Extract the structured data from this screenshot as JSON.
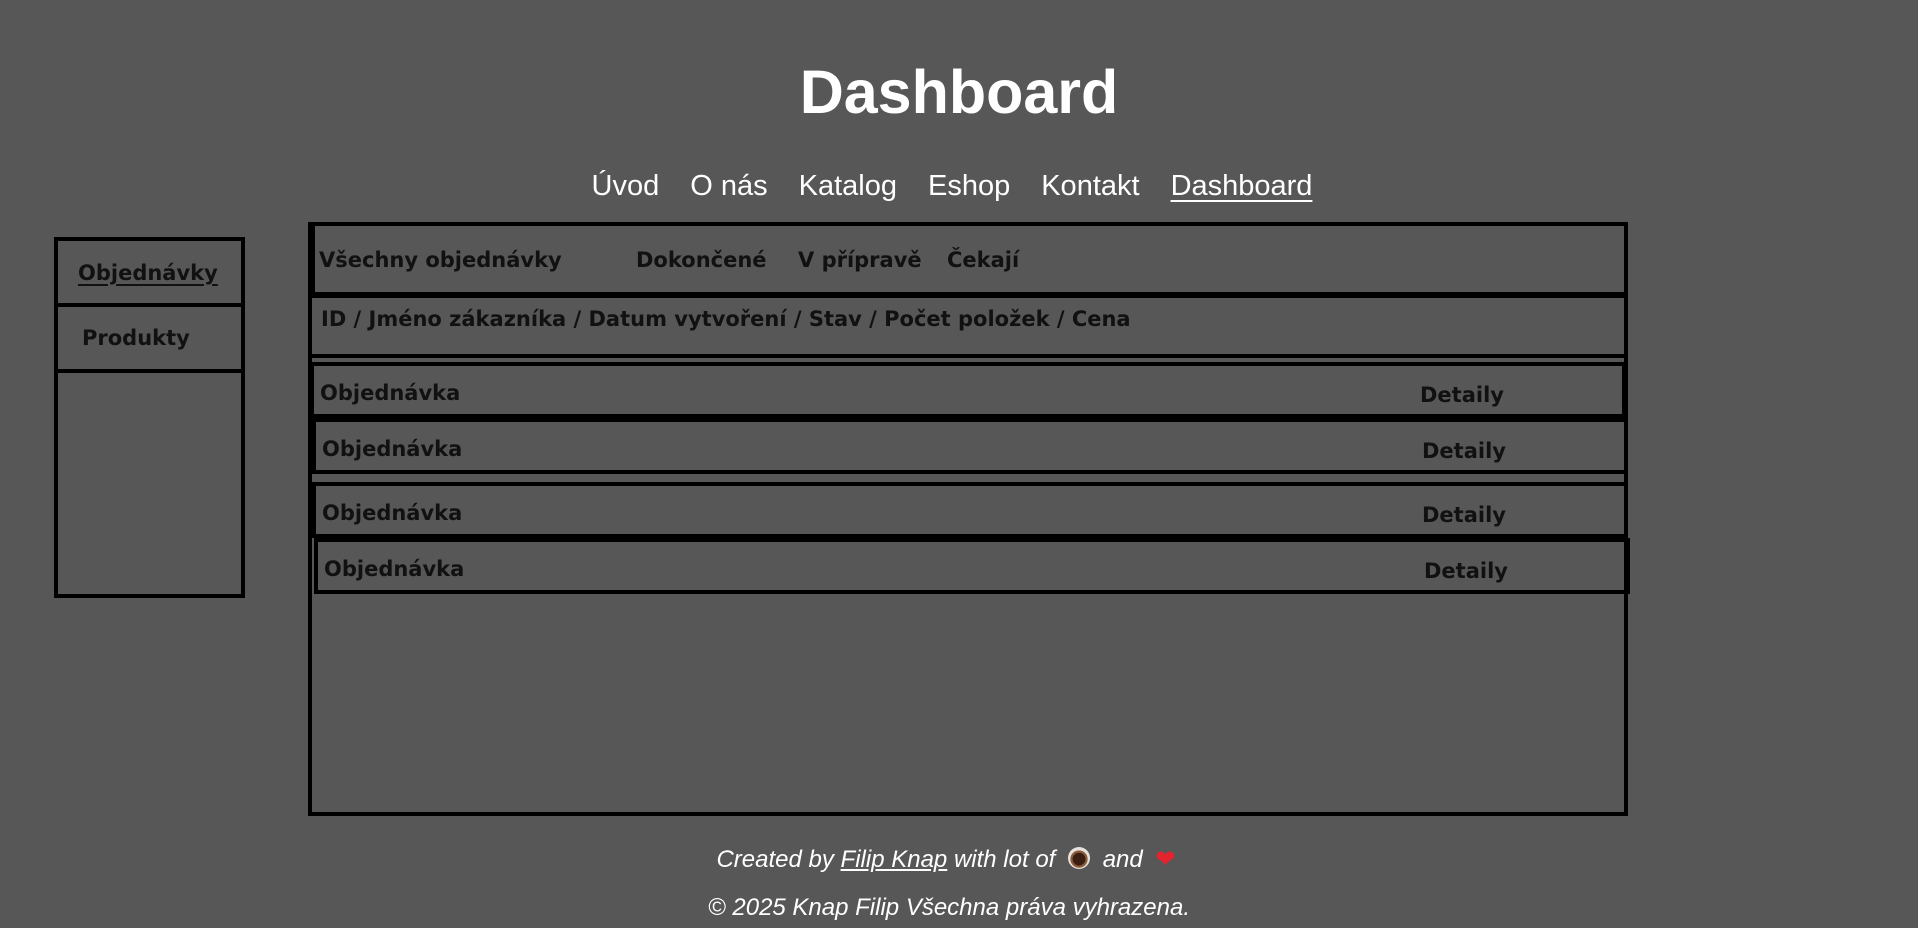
{
  "header": {
    "title": "Dashboard"
  },
  "nav": {
    "items": [
      {
        "label": "Úvod"
      },
      {
        "label": "O nás"
      },
      {
        "label": "Katalog"
      },
      {
        "label": "Eshop"
      },
      {
        "label": "Kontakt"
      },
      {
        "label": "Dashboard",
        "active": true
      }
    ]
  },
  "sidebar": {
    "items": [
      {
        "label": "Objednávky",
        "active": true
      },
      {
        "label": "Produkty"
      }
    ]
  },
  "filters": {
    "all": "Všechny objednávky",
    "done": "Dokončené",
    "in_progress": "V přípravě",
    "waiting": "Čekají"
  },
  "table": {
    "columns_text": "ID /  Jméno zákazníka /  Datum vytvoření / Stav / Počet položek / Cena"
  },
  "orders": [
    {
      "label": "Objednávka",
      "action": "Detaily"
    },
    {
      "label": "Objednávka",
      "action": "Detaily"
    },
    {
      "label": "Objednávka",
      "action": "Detaily"
    },
    {
      "label": "Objednávka",
      "action": "Detaily"
    }
  ],
  "footer": {
    "created_prefix": "Created by",
    "author": "Filip Knap",
    "with_text": "with lot of",
    "and_text": "and",
    "coffee_icon": "coffee-icon",
    "heart_icon": "heart-icon",
    "copyright": "© 2025 Knap Filip Všechna práva vyhrazena."
  }
}
